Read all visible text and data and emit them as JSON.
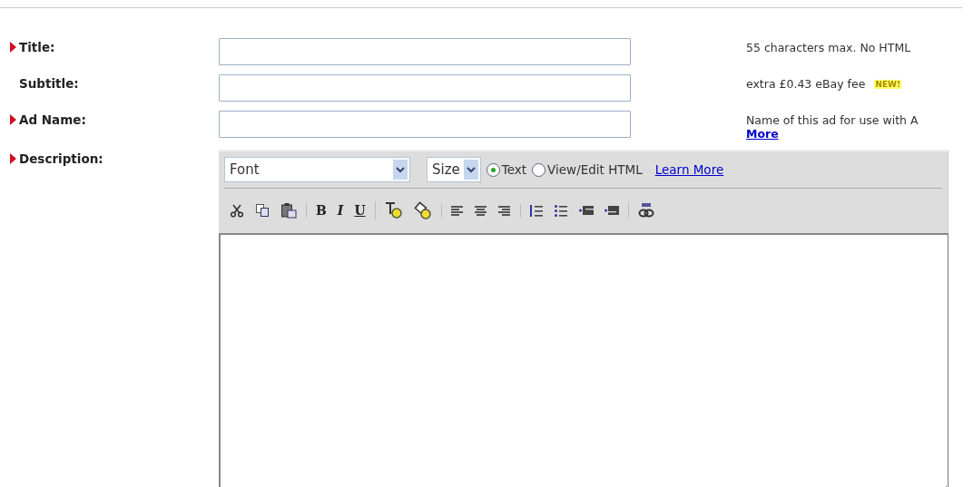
{
  "fields": [
    {
      "label": "Title:",
      "required": true,
      "hint": "55 characters max.  No HTML"
    },
    {
      "label": "Subtitle:",
      "required": false,
      "hint": "extra £0.43 eBay fee",
      "badge": "NEW!"
    },
    {
      "label": "Ad Name:",
      "required": true,
      "hint": "Name of this ad for use with A",
      "link": "More"
    }
  ],
  "description": {
    "label": "Description:",
    "required": true,
    "font_select": "Font",
    "size_select": "Size",
    "modes": [
      {
        "label": "Text",
        "selected": true
      },
      {
        "label": "View/Edit HTML",
        "selected": false
      }
    ],
    "help_link": "Learn More",
    "toolbar": [
      [
        {
          "kind": "cut"
        },
        {
          "kind": "copy"
        },
        {
          "kind": "paste"
        }
      ],
      [
        {
          "kind": "bold",
          "text": "B"
        },
        {
          "kind": "italic",
          "text": "I"
        },
        {
          "kind": "underline",
          "text": "U"
        }
      ],
      [
        {
          "kind": "textcolor"
        },
        {
          "kind": "highlight"
        }
      ],
      [
        {
          "kind": "alignleft"
        },
        {
          "kind": "aligncenter"
        },
        {
          "kind": "alignright"
        }
      ],
      [
        {
          "kind": "numbered"
        },
        {
          "kind": "bulleted"
        },
        {
          "kind": "outdent"
        },
        {
          "kind": "indent"
        }
      ],
      [
        {
          "kind": "link"
        }
      ]
    ]
  }
}
